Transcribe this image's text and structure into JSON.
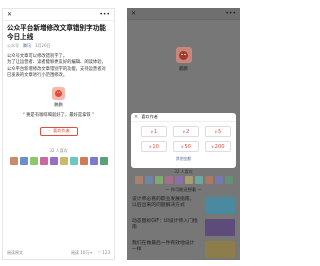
{
  "left": {
    "article": {
      "title": "公众平台新增修改文章错别字功能今日上线",
      "meta": {
        "source": "公众号",
        "author": "腾讯",
        "date": "3月26日"
      },
      "paragraphs": [
        "公众号文章可以修改错别字了。",
        "为了让运营者、读者能够更友好的编辑、阅读体验，公众平台新增修改文章错别字的功能，支持运营者对已发表的文章进行小范围修改。"
      ]
    },
    "author_name": "鹏鹏",
    "slogan": "要是有咖啡喝就好了，最好是拿铁",
    "like_button": "喜欢作者",
    "like_count": "32 人喜欢",
    "bottom": {
      "original": "阅读原文",
      "reads": "阅读 10万+",
      "likes": "123"
    }
  },
  "right": {
    "author_name": "鹏鹏",
    "popup": {
      "title": "喜欢作者",
      "currency": "¥",
      "amounts": [
        "1",
        "2",
        "5",
        "10",
        "50",
        "200"
      ],
      "other": "其他金额"
    },
    "like_count": "32 人喜欢",
    "section_title": "— 你可能还想看 —",
    "recommendations": [
      {
        "title": "设计师必看的职业发展指南，以后出来的问题解决方式",
        "color": "#4a8aa0"
      },
      {
        "title": "动态图标GIF：UI设计师入门指南",
        "color": "#5d4c7a"
      },
      {
        "title": "我们在做最后一件有效地设计一样",
        "color": "#8c7d4a"
      }
    ]
  },
  "colors": {
    "accent": "#e04c3d",
    "link": "#576b95"
  },
  "icons": [
    "close-icon",
    "more-icon",
    "heart-icon",
    "thumb-icon"
  ]
}
